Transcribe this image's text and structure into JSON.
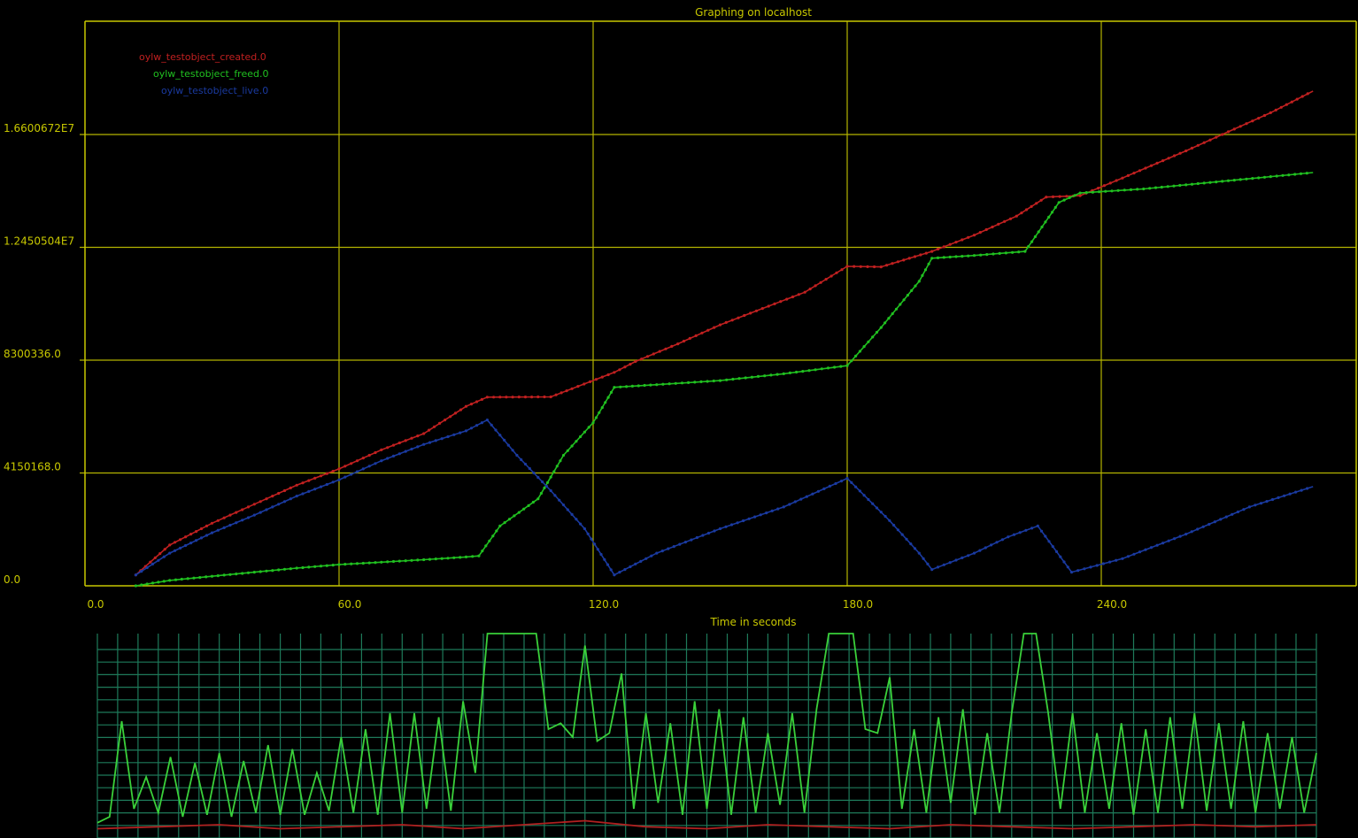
{
  "chart_data": [
    {
      "type": "line",
      "title": "Graphing on localhost",
      "xlabel": "Time in seconds",
      "ylabel": "",
      "xlim": [
        0,
        300
      ],
      "ylim": [
        0,
        16600672
      ],
      "x_ticks": [
        "0.0",
        "60.0",
        "120.0",
        "180.0",
        "240.0"
      ],
      "x_tick_values": [
        0,
        60,
        120,
        180,
        240
      ],
      "y_ticks": [
        "0.0",
        "4150168.0",
        "8300336.0",
        "1.2450504E7",
        "1.6600672E7"
      ],
      "y_tick_values": [
        0,
        4150168,
        8300336,
        12450504,
        16600672
      ],
      "grid": true,
      "legend": "top-left",
      "colors": {
        "axis": "#c8c800",
        "grid": "#b4b400",
        "title": "#c8c800"
      },
      "series": [
        {
          "name": "oylw_testobject_created.0",
          "color": "#c02020",
          "x": [
            12,
            20,
            30,
            40,
            50,
            60,
            70,
            80,
            90,
            95,
            110,
            115,
            125,
            130,
            140,
            150,
            160,
            170,
            180,
            188,
            200,
            210,
            220,
            227,
            235,
            245,
            260,
            270,
            280,
            290
          ],
          "y": [
            400000,
            1500000,
            2300000,
            3000000,
            3700000,
            4300000,
            5000000,
            5600000,
            6600000,
            6940000,
            6950000,
            7250000,
            7850000,
            8250000,
            8900000,
            9600000,
            10200000,
            10800000,
            11750000,
            11730000,
            12300000,
            12900000,
            13600000,
            14300000,
            14350000,
            15000000,
            16000000,
            16700000,
            17400000,
            18200000
          ]
        },
        {
          "name": "oylw_testobject_freed.0",
          "color": "#20c020",
          "x": [
            12,
            20,
            30,
            40,
            50,
            60,
            70,
            80,
            90,
            93,
            98,
            107,
            113,
            120,
            125,
            135,
            150,
            165,
            180,
            188,
            197,
            200,
            210,
            222,
            230,
            235,
            250,
            270,
            290
          ],
          "y": [
            0,
            200000,
            350000,
            500000,
            650000,
            780000,
            870000,
            960000,
            1060000,
            1100000,
            2200000,
            3200000,
            4800000,
            6000000,
            7300000,
            7400000,
            7550000,
            7800000,
            8100000,
            9500000,
            11200000,
            12050000,
            12150000,
            12300000,
            14100000,
            14450000,
            14600000,
            14900000,
            15200000
          ]
        },
        {
          "name": "oylw_testobject_live.0",
          "color": "#1a3aa0",
          "x": [
            12,
            20,
            30,
            40,
            50,
            60,
            70,
            80,
            90,
            95,
            102,
            110,
            118,
            125,
            135,
            150,
            165,
            180,
            190,
            197,
            200,
            210,
            218,
            225,
            233,
            245,
            260,
            275,
            290
          ],
          "y": [
            400000,
            1200000,
            1950000,
            2600000,
            3300000,
            3900000,
            4600000,
            5200000,
            5700000,
            6100000,
            4800000,
            3500000,
            2100000,
            400000,
            1200000,
            2100000,
            2900000,
            3950000,
            2400000,
            1200000,
            600000,
            1200000,
            1800000,
            2200000,
            500000,
            1000000,
            1900000,
            2900000,
            3650000
          ]
        }
      ]
    },
    {
      "type": "line",
      "title": "",
      "xlabel": "",
      "ylabel": "",
      "xlim": [
        0,
        300
      ],
      "ylim": [
        0,
        100
      ],
      "grid": true,
      "colors": {
        "grid": "#1e7a5a"
      },
      "series": [
        {
          "color": "#3ad03a",
          "x": [
            0,
            3,
            6,
            9,
            12,
            15,
            18,
            21,
            24,
            27,
            30,
            33,
            36,
            39,
            42,
            45,
            48,
            51,
            54,
            57,
            60,
            63,
            66,
            69,
            72,
            75,
            78,
            81,
            84,
            87,
            90,
            93,
            96,
            99,
            102,
            105,
            108,
            111,
            114,
            117,
            120,
            123,
            126,
            129,
            132,
            135,
            138,
            141,
            144,
            147,
            150,
            153,
            156,
            159,
            162,
            165,
            168,
            171,
            174,
            177,
            180,
            183,
            186,
            189,
            192,
            195,
            198,
            201,
            204,
            207,
            210,
            213,
            216,
            219,
            222,
            225,
            228,
            231,
            234,
            237,
            240,
            243,
            246,
            249,
            252,
            255,
            258,
            261,
            264,
            267,
            270,
            273,
            276,
            279,
            282,
            285,
            288,
            291,
            294,
            297,
            300
          ],
          "y": [
            5,
            8,
            56,
            12,
            28,
            10,
            38,
            8,
            35,
            9,
            40,
            8,
            36,
            10,
            44,
            9,
            42,
            9,
            30,
            11,
            48,
            10,
            52,
            9,
            60,
            10,
            60,
            12,
            58,
            11,
            66,
            30,
            100,
            100,
            100,
            100,
            100,
            52,
            55,
            48,
            94,
            46,
            50,
            80,
            12,
            60,
            15,
            55,
            9,
            66,
            12,
            62,
            9,
            58,
            10,
            50,
            14,
            60,
            10,
            62,
            100,
            100,
            100,
            52,
            50,
            78,
            12,
            52,
            10,
            58,
            15,
            62,
            9,
            50,
            10,
            60,
            100,
            100,
            60,
            12,
            60,
            10,
            50,
            12,
            55,
            9,
            52,
            10,
            58,
            12,
            60,
            11,
            55,
            12,
            56,
            10,
            50,
            12,
            48,
            10,
            40
          ]
        },
        {
          "color": "#b02020",
          "x": [
            0,
            15,
            30,
            45,
            60,
            75,
            90,
            105,
            120,
            135,
            150,
            165,
            180,
            195,
            210,
            225,
            240,
            255,
            270,
            285,
            300
          ],
          "y": [
            2,
            3,
            4,
            2,
            3,
            4,
            2,
            4,
            6,
            3,
            2,
            4,
            3,
            2,
            4,
            3,
            2,
            3,
            4,
            3,
            4
          ]
        }
      ]
    }
  ]
}
